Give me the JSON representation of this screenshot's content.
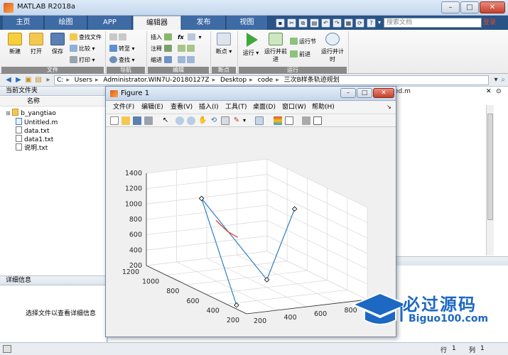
{
  "window": {
    "title": "MATLAB R2018a"
  },
  "tabs": [
    "主页",
    "绘图",
    "APP",
    "编辑器",
    "发布",
    "视图"
  ],
  "active_tab": "编辑器",
  "search": {
    "placeholder": "搜索文档",
    "login": "登录"
  },
  "ribbon": {
    "file_group": {
      "label": "文件",
      "new": "新建",
      "open": "打开",
      "save": "保存",
      "find_files": "查找文件",
      "compare": "比较",
      "print": "打印"
    },
    "nav_group": {
      "label": "导航",
      "goto": "转至",
      "find": "查找"
    },
    "edit_group": {
      "label": "编辑",
      "insert": "插入",
      "comment": "注释",
      "indent": "缩进",
      "fx": "fx"
    },
    "breakpoint_group": {
      "label": "断点",
      "breakpoints": "断点"
    },
    "run_group": {
      "label": "运行",
      "run": "运行",
      "run_advance": "运行并前进",
      "run_section": "运行节",
      "advance": "前进",
      "run_time": "运行并计时"
    }
  },
  "path": [
    "C:",
    "Users",
    "Administrator.WIN7U-20180127Z",
    "Desktop",
    "code",
    "三次B样条轨迹规划"
  ],
  "current_folder": {
    "title": "当前文件夹",
    "column": "名称",
    "items": [
      {
        "name": "b_yangtiao",
        "type": "folder"
      },
      {
        "name": "Untitled.m",
        "type": "mfile"
      },
      {
        "name": "data.txt",
        "type": "text"
      },
      {
        "name": "data1.txt",
        "type": "text"
      },
      {
        "name": "说明.txt",
        "type": "text"
      }
    ]
  },
  "details": {
    "title": "详细信息",
    "message": "选择文件以查看详细信息"
  },
  "editor": {
    "tab_fragment": "ed.m"
  },
  "statusbar": {
    "row_label": "行",
    "row_value": "1",
    "col_label": "列",
    "col_value": "1"
  },
  "figure": {
    "title": "Figure 1",
    "menu": [
      "文件(F)",
      "编辑(E)",
      "查看(V)",
      "插入(I)",
      "工具(T)",
      "桌面(D)",
      "窗口(W)",
      "帮助(H)"
    ]
  },
  "chart_data": {
    "type": "line",
    "projection": "3d",
    "z_ticks": [
      200,
      400,
      600,
      800,
      1000,
      1200,
      1400
    ],
    "x_ticks": [
      200,
      400,
      600,
      800,
      1000,
      1200
    ],
    "y_ticks": [
      200,
      400,
      600,
      800,
      1000
    ],
    "zlim": [
      200,
      1400
    ],
    "xlim": [
      200,
      1200
    ],
    "ylim": [
      200,
      1000
    ],
    "grid": true,
    "series": [
      {
        "style": "control-polygon",
        "color": "#2f7fc4",
        "marker": "diamond",
        "points": [
          {
            "x": 300,
            "y": 200,
            "z": 250
          },
          {
            "x": 800,
            "y": 300,
            "z": 1300
          },
          {
            "x": 600,
            "y": 600,
            "z": 300
          },
          {
            "x": 700,
            "y": 850,
            "z": 1100
          }
        ]
      },
      {
        "style": "curve",
        "color": "#d9472b",
        "points": [
          {
            "x": 700,
            "y": 330,
            "z": 1070
          },
          {
            "x": 660,
            "y": 380,
            "z": 940
          },
          {
            "x": 620,
            "y": 420,
            "z": 880
          }
        ]
      }
    ]
  },
  "watermark": {
    "title": "必过源码",
    "subtitle": "Biguo100.com"
  }
}
